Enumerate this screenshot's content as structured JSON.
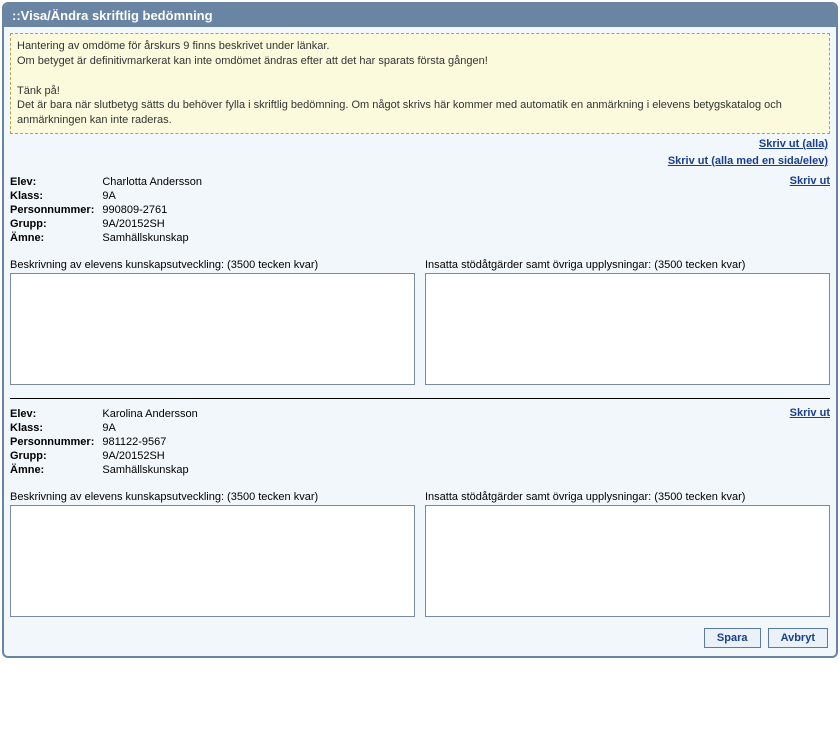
{
  "title": "::Visa/Ändra skriftlig bedömning",
  "notice": {
    "line1": "Hantering av omdöme för årskurs 9 finns beskrivet under länkar.",
    "line2": "Om betyget är definitivmarkerat kan inte omdömet ändras efter att det har sparats första gången!",
    "line3": "Tänk på!",
    "line4": "Det är bara när slutbetyg sätts du behöver fylla i skriftlig bedömning. Om något skrivs här kommer med automatik en anmärkning i elevens betygskatalog och anmärkningen kan inte raderas."
  },
  "links": {
    "print_all": "Skriv ut (alla)",
    "print_all_page": "Skriv ut (alla med en sida/elev)",
    "print": "Skriv ut"
  },
  "labels": {
    "elev": "Elev:",
    "klass": "Klass:",
    "personnummer": "Personnummer:",
    "grupp": "Grupp:",
    "amne": "Ämne:",
    "ta1": "Beskrivning av elevens kunskapsutveckling: (3500 tecken kvar)",
    "ta2": "Insatta stödåtgärder samt övriga upplysningar: (3500 tecken kvar)"
  },
  "students": [
    {
      "elev": "Charlotta Andersson",
      "klass": "9A",
      "personnummer": "990809-2761",
      "grupp": "9A/20152SH",
      "amne": "Samhällskunskap"
    },
    {
      "elev": "Karolina Andersson",
      "klass": "9A",
      "personnummer": "981122-9567",
      "grupp": "9A/20152SH",
      "amne": "Samhällskunskap"
    }
  ],
  "buttons": {
    "save": "Spara",
    "cancel": "Avbryt"
  }
}
